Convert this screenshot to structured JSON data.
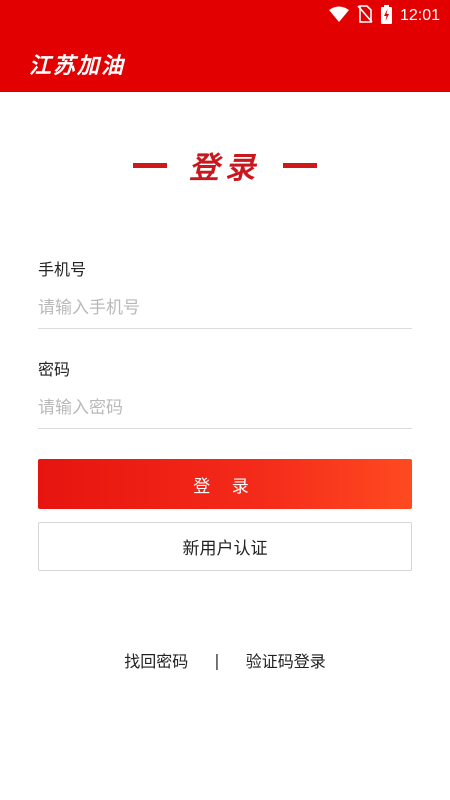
{
  "status_bar": {
    "time": "12:01",
    "icons": [
      "wifi-icon",
      "no-sim-icon",
      "battery-charging-icon"
    ]
  },
  "app_bar": {
    "title": "江苏加油"
  },
  "page_heading": "登录",
  "form": {
    "phone": {
      "label": "手机号",
      "placeholder": "请输入手机号",
      "value": ""
    },
    "password": {
      "label": "密码",
      "placeholder": "请输入密码",
      "value": ""
    }
  },
  "buttons": {
    "login": "登 录",
    "register": "新用户认证"
  },
  "links": {
    "recover_password": "找回密码",
    "separator": "|",
    "sms_login": "验证码登录"
  },
  "colors": {
    "brand_red": "#e20000",
    "button_gradient_start": "#e7140f",
    "button_gradient_end": "#ff4a20"
  }
}
